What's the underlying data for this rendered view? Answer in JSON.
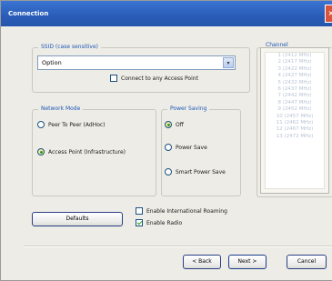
{
  "window": {
    "title": "Connection",
    "close_glyph": "×"
  },
  "ssid": {
    "group_label": "SSID (case sensitive)",
    "value": "Option",
    "dropdown_glyph": "▾",
    "connect_any_label": "Connect to any Access Point",
    "connect_any_checked": false
  },
  "network_mode": {
    "group_label": "Network Mode",
    "options": [
      {
        "label": "Peer To Peer (AdHoc)",
        "selected": false
      },
      {
        "label": "Access Point (Infrastructure)",
        "selected": true
      }
    ]
  },
  "power_saving": {
    "group_label": "Power Saving",
    "options": [
      {
        "label": "Off",
        "selected": true
      },
      {
        "label": "Power Save",
        "selected": false
      },
      {
        "label": "Smart Power Save",
        "selected": false
      }
    ]
  },
  "channel": {
    "group_label": "Channel",
    "items": [
      "1 (2412 MHz)",
      "2 (2417 MHz)",
      "3 (2422 MHz)",
      "4 (2427 MHz)",
      "5 (2432 MHz)",
      "6 (2437 MHz)",
      "7 (2442 MHz)",
      "8 (2447 MHz)",
      "9 (2452 MHz)",
      "10 (2457 MHz)",
      "11 (2462 MHz)",
      "12 (2467 MHz)",
      "13 (2472 MHz)"
    ]
  },
  "options": {
    "defaults_label": "Defaults",
    "intl_roaming_label": "Enable International Roaming",
    "intl_roaming_checked": false,
    "radio_label": "Enable Radio",
    "radio_checked": true
  },
  "footer": {
    "back_label": "< Back",
    "next_label": "Next >",
    "cancel_label": "Cancel"
  }
}
